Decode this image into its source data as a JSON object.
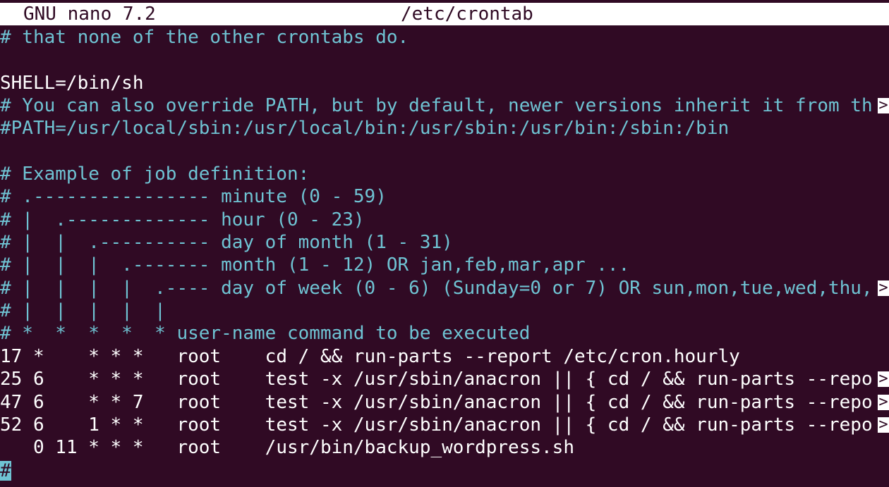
{
  "header": {
    "app_title": "GNU nano 7.2",
    "file_name": "/etc/crontab"
  },
  "colors": {
    "background": "#300a24",
    "comment": "#6fc3d3",
    "text": "#ffffff"
  },
  "lines": [
    "# that none of the other crontabs do.",
    "",
    "SHELL=/bin/sh",
    "# You can also override PATH, but by default, newer versions inherit it from th",
    "#PATH=/usr/local/sbin:/usr/local/bin:/usr/sbin:/usr/bin:/sbin:/bin",
    "",
    "# Example of job definition:",
    "# .---------------- minute (0 - 59)",
    "# |  .------------- hour (0 - 23)",
    "# |  |  .---------- day of month (1 - 31)",
    "# |  |  |  .------- month (1 - 12) OR jan,feb,mar,apr ...",
    "# |  |  |  |  .---- day of week (0 - 6) (Sunday=0 or 7) OR sun,mon,tue,wed,thu,",
    "# |  |  |  |  |",
    "# *  *  *  *  * user-name command to be executed",
    "17 *    * * *   root    cd / && run-parts --report /etc/cron.hourly",
    "25 6    * * *   root    test -x /usr/sbin/anacron || { cd / && run-parts --repo",
    "47 6    * * 7   root    test -x /usr/sbin/anacron || { cd / && run-parts --repo",
    "52 6    1 * *   root    test -x /usr/sbin/anacron || { cd / && run-parts --repo",
    "   0 11 * * *   root    /usr/bin/backup_wordpress.sh",
    "#"
  ],
  "truncation_marker": ">"
}
